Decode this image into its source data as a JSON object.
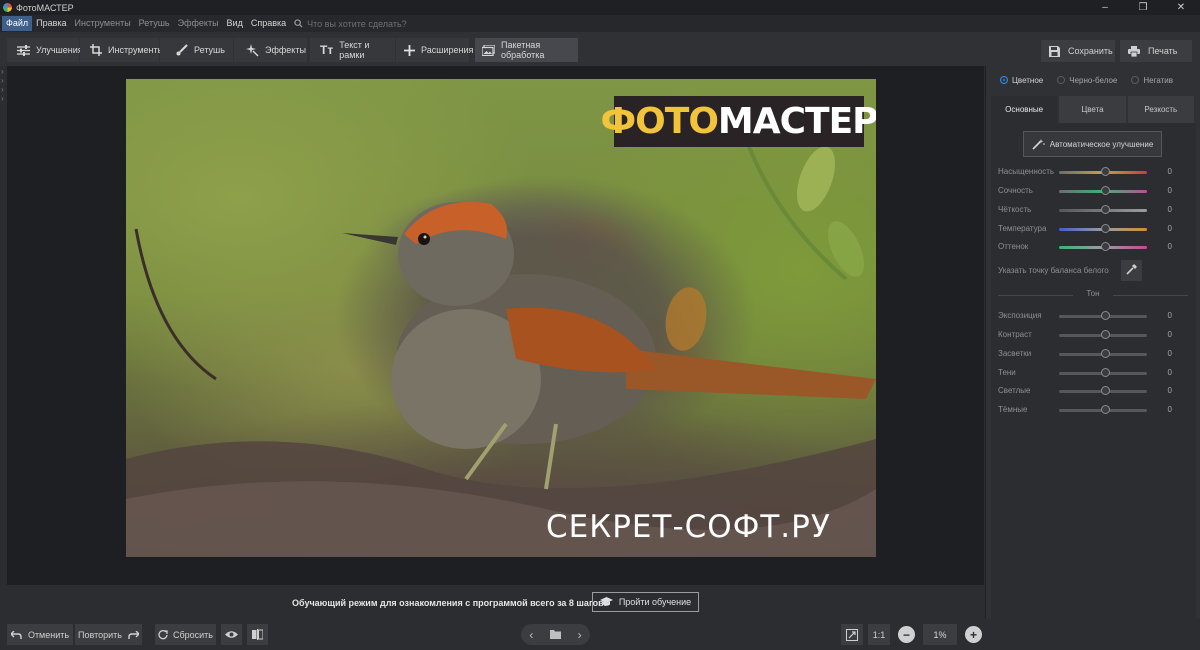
{
  "window": {
    "title": "ФотоМАСТЕР",
    "controls": [
      "–",
      "❐",
      "✕"
    ]
  },
  "menu": {
    "items": [
      {
        "label": "Файл",
        "state": "active"
      },
      {
        "label": "Правка",
        "state": "normal"
      },
      {
        "label": "Инструменты",
        "state": "dim"
      },
      {
        "label": "Ретушь",
        "state": "dim"
      },
      {
        "label": "Эффекты",
        "state": "dim"
      },
      {
        "label": "Вид",
        "state": "normal"
      },
      {
        "label": "Справка",
        "state": "normal"
      }
    ],
    "search_placeholder": "Что вы хотите сделать?"
  },
  "toolbar": {
    "tabs": [
      {
        "label": "Улучшения",
        "icon": "sliders-icon"
      },
      {
        "label": "Инструменты",
        "icon": "crop-icon"
      },
      {
        "label": "Ретушь",
        "icon": "brush-icon"
      },
      {
        "label": "Эффекты",
        "icon": "sparkle-icon"
      },
      {
        "label": "Текст и рамки",
        "icon": "text-icon"
      },
      {
        "label": "Расширения",
        "icon": "plus-icon"
      },
      {
        "label": "Пакетная обработка",
        "icon": "batch-icon"
      }
    ],
    "save_label": "Сохранить",
    "print_label": "Печать"
  },
  "photo": {
    "logo_part1": "ФОТО",
    "logo_part2": "МАСТЕР",
    "watermark": "СЕКРЕТ-СОФТ.РУ"
  },
  "tutorial": {
    "text": "Обучающий режим для ознакомления с программой всего за 8 шагов!",
    "button_label": "Пройти обучение"
  },
  "bottom": {
    "undo_label": "Отменить",
    "redo_label": "Повторить",
    "reset_label": "Сбросить",
    "one_to_one": "1:1",
    "zoom": "1%"
  },
  "panel": {
    "modes": [
      {
        "label": "Цветное",
        "checked": true
      },
      {
        "label": "Черно-белое",
        "checked": false
      },
      {
        "label": "Негатив",
        "checked": false
      }
    ],
    "tabs": [
      {
        "label": "Основные",
        "active": true
      },
      {
        "label": "Цвета",
        "active": false
      },
      {
        "label": "Резкость",
        "active": false
      }
    ],
    "auto_label": "Автоматическое улучшение",
    "color_sliders": [
      {
        "label": "Насыщенность",
        "value": "0",
        "gradient": "linear-gradient(90deg,#6b6d70,#c8a040,#c04040)"
      },
      {
        "label": "Сочность",
        "value": "0",
        "gradient": "linear-gradient(90deg,#6b6d70,#3cb371,#c04a9a)"
      },
      {
        "label": "Чёткость",
        "value": "0",
        "gradient": "linear-gradient(90deg,#55575b,#9a9ca0)"
      },
      {
        "label": "Температура",
        "value": "0",
        "gradient": "linear-gradient(90deg,#4060c8,#9a9ca0,#d09030)"
      },
      {
        "label": "Оттенок",
        "value": "0",
        "gradient": "linear-gradient(90deg,#3cb371,#9a9ca0,#c04a9a)"
      }
    ],
    "white_balance_label": "Указать точку баланса белого",
    "tone_title": "Тон",
    "tone_sliders": [
      {
        "label": "Экспозиция",
        "value": "0"
      },
      {
        "label": "Контраст",
        "value": "0"
      },
      {
        "label": "Засветки",
        "value": "0"
      },
      {
        "label": "Тени",
        "value": "0"
      },
      {
        "label": "Светлые",
        "value": "0"
      },
      {
        "label": "Тёмные",
        "value": "0"
      }
    ]
  }
}
